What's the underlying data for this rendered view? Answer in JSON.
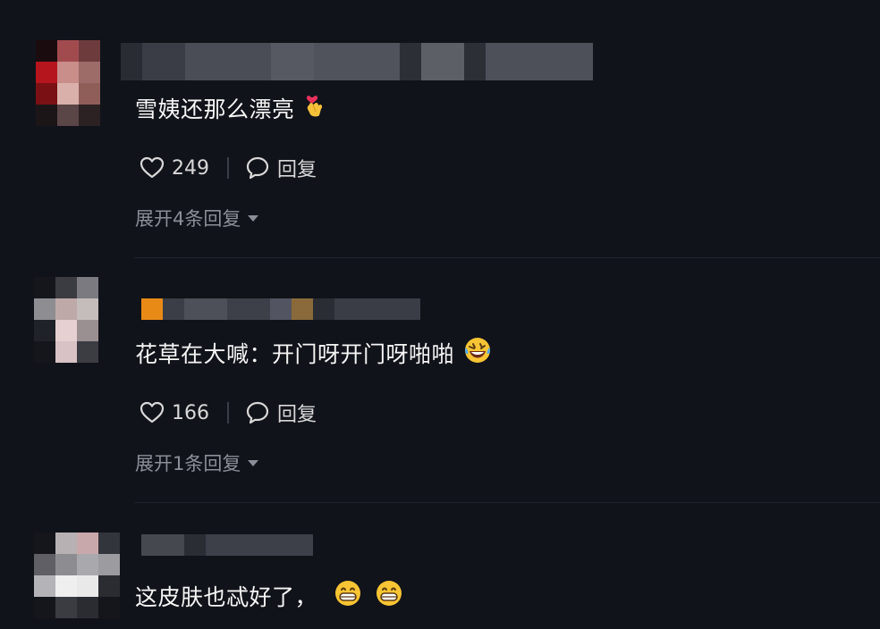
{
  "comments": [
    {
      "text": "雪姨还那么漂亮",
      "emoji": "finger-heart-emoji",
      "likes": "249",
      "reply_label": "回复",
      "expand_label": "展开4条回复"
    },
    {
      "text": "花草在大喊：开门呀开门呀啪啪",
      "emoji": "rolling-laugh-emoji",
      "likes": "166",
      "reply_label": "回复",
      "expand_label": "展开1条回复"
    },
    {
      "text": "这皮肤也忒好了，",
      "emoji": "grin-emoji",
      "likes": "",
      "reply_label": "",
      "expand_label": ""
    }
  ],
  "colors": {
    "background": "#11131a",
    "text": "#f5f5f5",
    "muted": "#8b8e97",
    "accent_orange": "#e88a16"
  }
}
